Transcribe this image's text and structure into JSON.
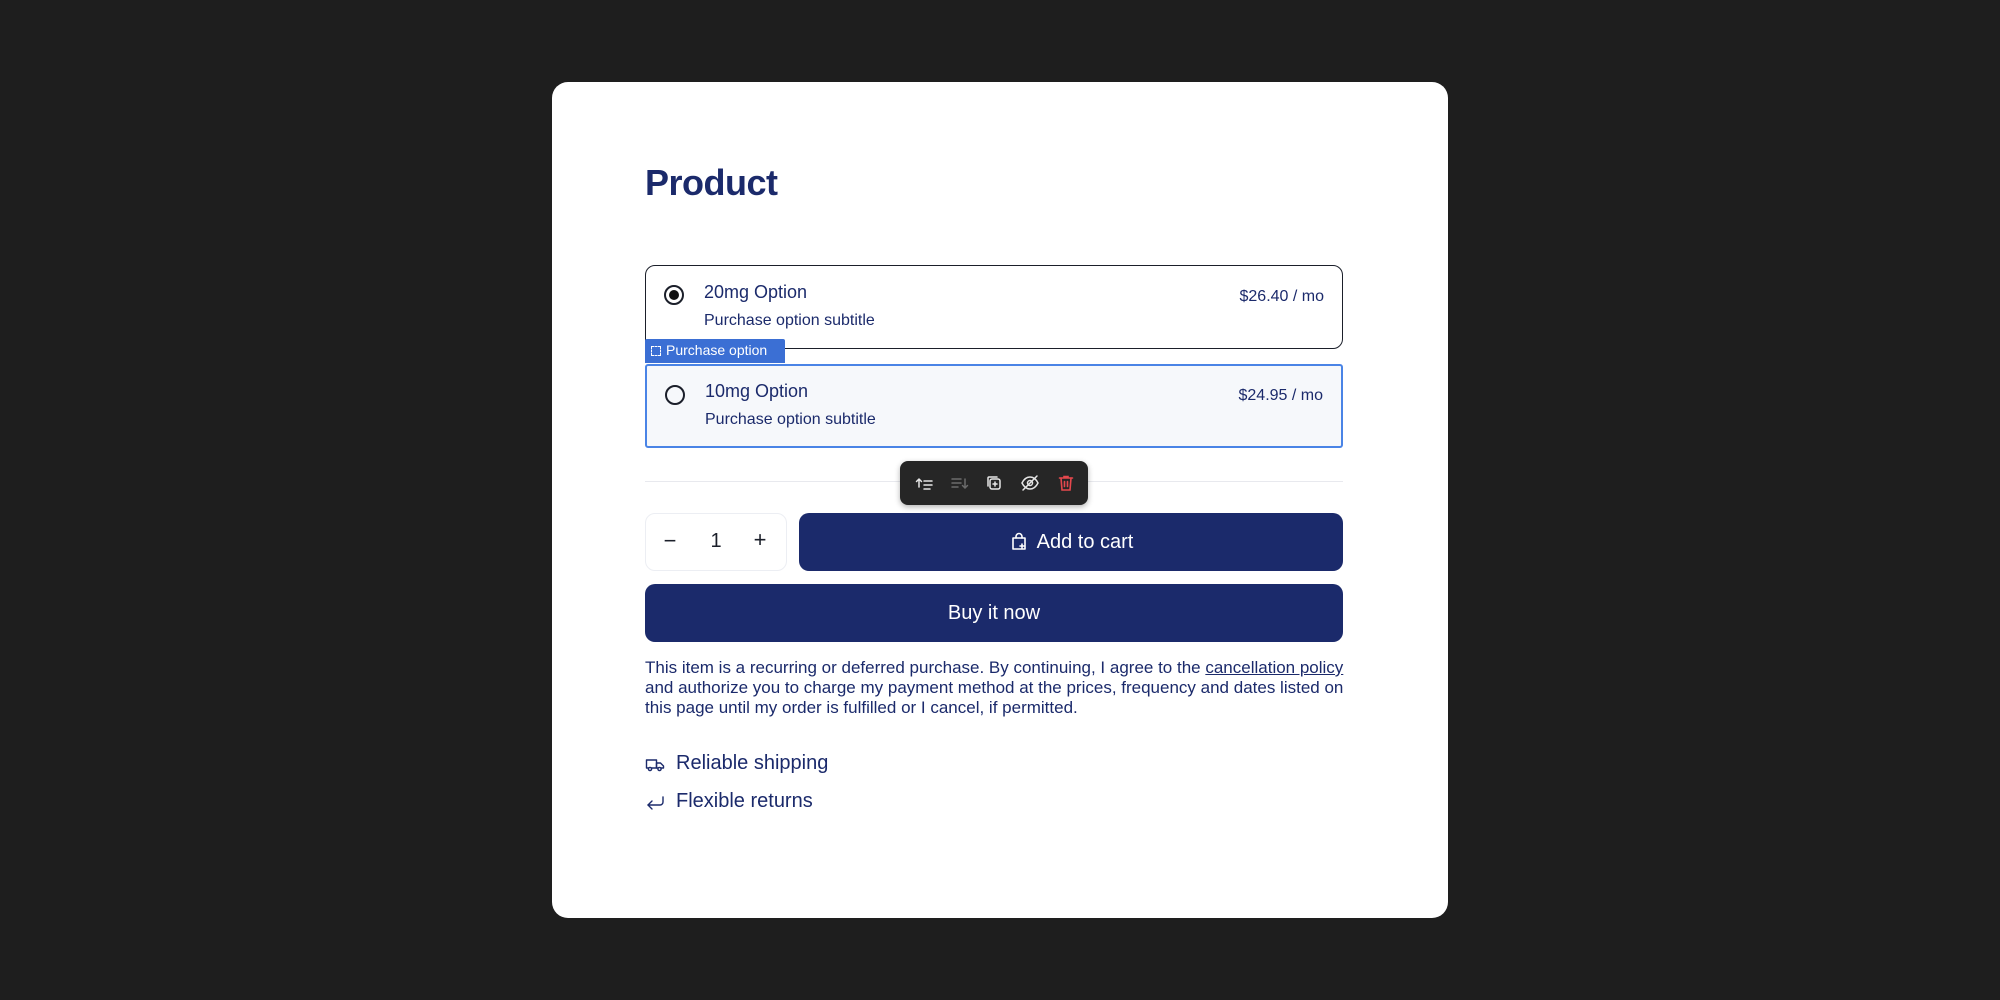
{
  "product": {
    "title": "Product",
    "options": [
      {
        "name": "20mg Option",
        "subtitle": "Purchase option subtitle",
        "price": "$26.40 / mo",
        "selected": true
      },
      {
        "name": "10mg Option",
        "subtitle": "Purchase option subtitle",
        "price": "$24.95 / mo",
        "selected": false
      }
    ],
    "selection_tag": "Purchase option",
    "quantity": {
      "minus": "−",
      "value": "1",
      "plus": "+"
    },
    "add_to_cart": "Add to cart",
    "buy_now": "Buy it now",
    "legal": {
      "before_link": "This item is a recurring or deferred purchase. By continuing, I agree to the ",
      "link": "cancellation policy",
      "after_link": " and authorize you to charge my payment method at the prices, frequency and dates listed on this page until my order is fulfilled or I cancel, if permitted."
    },
    "features": [
      {
        "icon": "truck-icon",
        "label": "Reliable shipping"
      },
      {
        "icon": "return-arrow-icon",
        "label": "Flexible returns"
      }
    ]
  },
  "toolbar": {
    "icons": [
      "move-up-icon",
      "move-down-icon",
      "duplicate-icon",
      "hide-icon",
      "delete-icon"
    ]
  },
  "colors": {
    "page_bg": "#1e1e1e",
    "brand_navy": "#1b2a6b",
    "selection_blue": "#3b6fd4",
    "delete_red": "#e5484d"
  }
}
